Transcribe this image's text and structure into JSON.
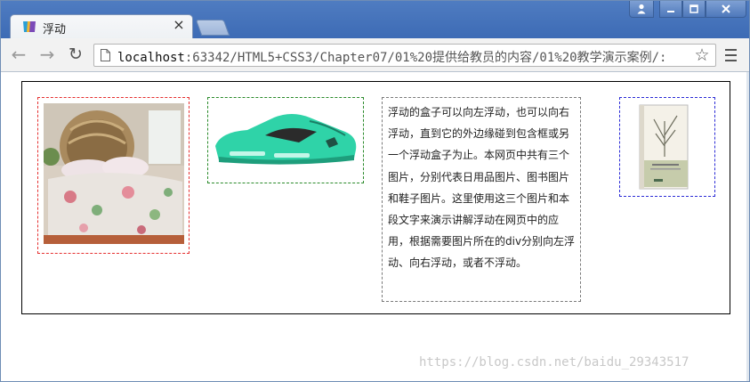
{
  "tab": {
    "title": "浮动",
    "close": "×"
  },
  "window_controls": {
    "user": "👤",
    "minimize": "—",
    "maximize": "□",
    "close": "X"
  },
  "toolbar": {
    "back": "←",
    "forward": "→",
    "reload": "↻",
    "url_host": "localhost",
    "url_rest": ":63342/HTML5+CSS3/Chapter07/01%20提供给教员的内容/01%20教学演示案例/:",
    "bookmark": "☆"
  },
  "page": {
    "paragraph": "浮动的盒子可以向左浮动，也可以向右浮动，直到它的外边缘碰到包含框或另一个浮动盒子为止。本网页中共有三个图片，分别代表日用品图片、图书图片和鞋子图片。这里使用这三个图片和本段文字来演示讲解浮动在网页中的应用，根据需要图片所在的div分别向左浮动、向右浮动，或者不浮动。"
  },
  "watermark": "https://blog.csdn.net/baidu_29343517",
  "colors": {
    "bed_box_border": "#e53030",
    "shoe_box_border": "#2a8a2a",
    "text_box_border": "#7a7a7a",
    "book_box_border": "#2b2bd6",
    "shoe": "#2fd3a8"
  }
}
